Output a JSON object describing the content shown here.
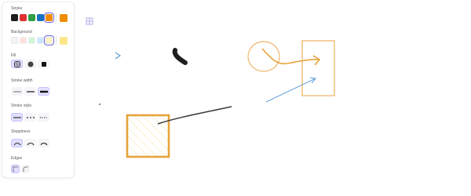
{
  "panel": {
    "stroke": {
      "title": "Stroke",
      "colors": [
        {
          "name": "black",
          "hex": "#1e1e1e"
        },
        {
          "name": "red",
          "hex": "#e03131"
        },
        {
          "name": "green",
          "hex": "#2f9e44"
        },
        {
          "name": "blue",
          "hex": "#1971c2"
        },
        {
          "name": "orange",
          "hex": "#f08c00"
        }
      ],
      "current": "#f08c00"
    },
    "background": {
      "title": "Background",
      "colors": [
        {
          "name": "transparent",
          "hex": "transparent"
        },
        {
          "name": "light-red",
          "hex": "#ffc9c9"
        },
        {
          "name": "light-green",
          "hex": "#b2f2bb"
        },
        {
          "name": "light-blue",
          "hex": "#a5d8ff"
        },
        {
          "name": "light-yellow",
          "hex": "#ffec99"
        }
      ],
      "current": "#ffec99"
    },
    "fill": {
      "title": "Fill",
      "options": [
        "hachure",
        "cross-hatch",
        "solid"
      ],
      "selected": "hachure"
    },
    "stroke_width": {
      "title": "Stroke width",
      "options": [
        "thin",
        "bold",
        "extra-bold"
      ],
      "selected": "extra-bold"
    },
    "stroke_style": {
      "title": "Stroke style",
      "options": [
        "solid",
        "dashed",
        "dotted"
      ],
      "selected": "solid"
    },
    "sloppiness": {
      "title": "Sloppiness",
      "options": [
        "architect",
        "artist",
        "cartoonist"
      ],
      "selected": "architect"
    },
    "edges": {
      "title": "Edges",
      "options": [
        "sharp",
        "round"
      ],
      "selected": "sharp"
    }
  },
  "canvas": {
    "accent": "#6965db",
    "elements": [
      "grid-handle-icon",
      "chevron",
      "black-scribble",
      "orange-circle",
      "orange-curved-arrow",
      "orange-rectangle",
      "blue-arrow",
      "dot",
      "hatched-square",
      "dark-line"
    ]
  }
}
